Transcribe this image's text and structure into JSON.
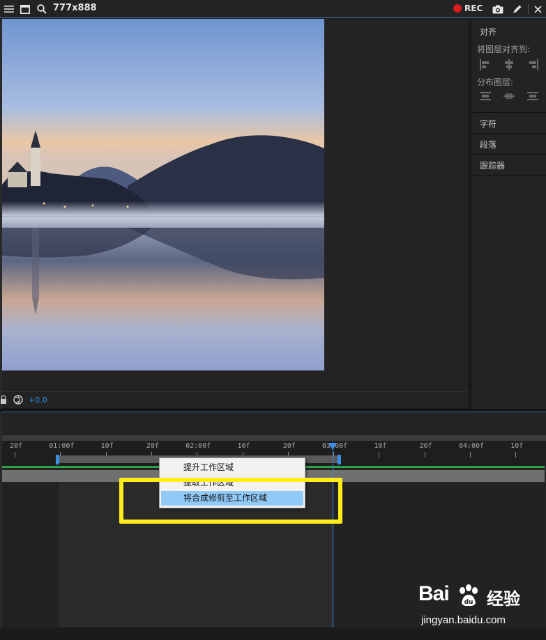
{
  "titlebar": {
    "size_label": "777x888",
    "rec_label": "REC"
  },
  "viewer": {
    "exposure_value": "+0.0"
  },
  "right_panel": {
    "align_title": "对齐",
    "align_layers_to": "将图层对齐到:",
    "distribute_layers": "分布图层:",
    "character": "字符",
    "paragraph": "段落",
    "tracker": "跟踪器"
  },
  "timeline": {
    "ruler_labels": [
      "20f",
      "01:00f",
      "10f",
      "20f",
      "02:00f",
      "10f",
      "20f",
      "03:00f",
      "10f",
      "20f",
      "04:00f",
      "10f"
    ]
  },
  "context_menu": {
    "items": [
      {
        "label": "提升工作区域"
      },
      {
        "label": "提取工作区域"
      },
      {
        "label": "将合成修剪至工作区域"
      }
    ],
    "highlighted_index": 2
  },
  "watermark": {
    "logo_text": "Bai",
    "logo_suffix": "经验",
    "url": "jingyan.baidu.com"
  },
  "colors": {
    "accent": "#3a8ee6",
    "highlight_box": "#ffec1a",
    "rec": "#d71d1d",
    "menu_highlight": "#91c9f7",
    "work_area_line": "#2fa34a"
  }
}
